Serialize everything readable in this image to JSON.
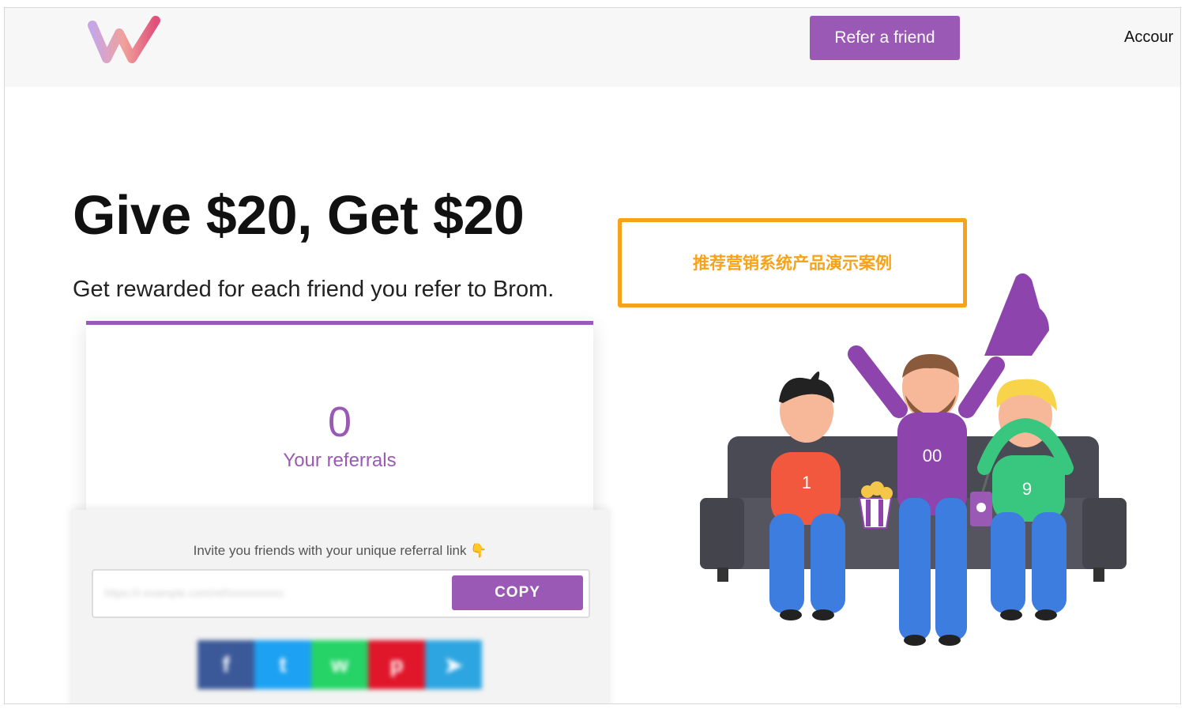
{
  "header": {
    "refer_button": "Refer a friend",
    "account_link": "Accour"
  },
  "hero": {
    "title": "Give $20, Get $20",
    "subtitle": "Get rewarded for each friend you refer to Brom."
  },
  "referrals": {
    "count": "0",
    "label": "Your referrals"
  },
  "invite": {
    "text": "Invite you friends with your unique referral link 👇",
    "link_value": "https://r.example.com/ref/xxxxxxxxxx",
    "copy_label": "COPY"
  },
  "social": [
    {
      "name": "facebook",
      "glyph": "f",
      "color": "#3b5998"
    },
    {
      "name": "twitter",
      "glyph": "t",
      "color": "#1da1f2"
    },
    {
      "name": "whatsapp",
      "glyph": "w",
      "color": "#25d366"
    },
    {
      "name": "pinterest",
      "glyph": "p",
      "color": "#e0162b"
    },
    {
      "name": "telegram",
      "glyph": "➤",
      "color": "#2ca5e0"
    }
  ],
  "annotation": "推荐营销系统产品演示案例",
  "illustration": {
    "jerseys": [
      "1",
      "00",
      "9"
    ]
  },
  "colors": {
    "accent": "#9b59b6",
    "annotation": "#f7a21b"
  }
}
